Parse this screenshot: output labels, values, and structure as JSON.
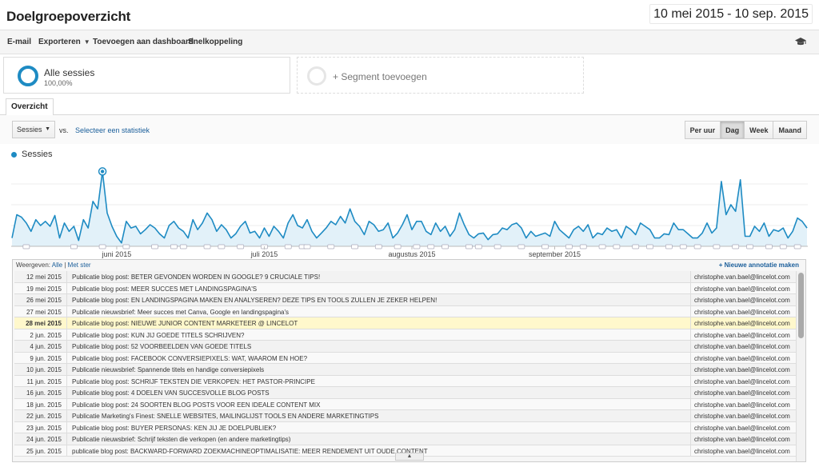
{
  "header": {
    "title": "Doelgroepoverzicht",
    "date_start": "10 mei 2015",
    "date_sep": "-",
    "date_end": "10 sep. 2015"
  },
  "toolbar": {
    "email_label": "E-mail",
    "export_label": "Exporteren",
    "dashboard_label": "Toevoegen aan dashboard",
    "shortcut_label": "Snelkoppeling",
    "icon": "mortarboard-icon"
  },
  "segments": {
    "all_sessions_label": "Alle sessies",
    "all_sessions_pct": "100,00%",
    "add_segment_label": "+ Segment toevoegen"
  },
  "tabs": {
    "overview_label": "Overzicht"
  },
  "controls": {
    "metric_label": "Sessies",
    "vs_label": "vs.",
    "select_stat_label": "Selecteer een statistiek",
    "period_buttons": [
      "Per uur",
      "Dag",
      "Week",
      "Maand"
    ],
    "active_period": "Dag"
  },
  "chart_data": {
    "type": "area",
    "series": [
      {
        "name": "Sessies",
        "color": "#1e8bc3"
      }
    ],
    "x_tick_labels": [
      "juni 2015",
      "juli 2015",
      "augustus 2015",
      "september 2015"
    ],
    "values": [
      0.1,
      0.38,
      0.35,
      0.28,
      0.18,
      0.32,
      0.25,
      0.3,
      0.24,
      0.37,
      0.1,
      0.28,
      0.18,
      0.24,
      0.07,
      0.32,
      0.22,
      0.54,
      0.45,
      0.9,
      0.4,
      0.24,
      0.12,
      0.04,
      0.3,
      0.22,
      0.24,
      0.15,
      0.2,
      0.26,
      0.22,
      0.15,
      0.1,
      0.25,
      0.3,
      0.22,
      0.18,
      0.1,
      0.32,
      0.2,
      0.28,
      0.4,
      0.32,
      0.18,
      0.26,
      0.2,
      0.1,
      0.15,
      0.24,
      0.3,
      0.16,
      0.18,
      0.1,
      0.22,
      0.12,
      0.24,
      0.18,
      0.1,
      0.28,
      0.38,
      0.25,
      0.22,
      0.32,
      0.18,
      0.1,
      0.16,
      0.22,
      0.3,
      0.26,
      0.36,
      0.28,
      0.45,
      0.3,
      0.24,
      0.14,
      0.3,
      0.26,
      0.18,
      0.2,
      0.28,
      0.1,
      0.16,
      0.26,
      0.38,
      0.2,
      0.3,
      0.3,
      0.18,
      0.14,
      0.28,
      0.18,
      0.24,
      0.12,
      0.2,
      0.4,
      0.26,
      0.14,
      0.1,
      0.15,
      0.16,
      0.08,
      0.14,
      0.15,
      0.22,
      0.2,
      0.26,
      0.28,
      0.22,
      0.1,
      0.18,
      0.12,
      0.14,
      0.16,
      0.12,
      0.3,
      0.2,
      0.15,
      0.1,
      0.2,
      0.24,
      0.18,
      0.26,
      0.1,
      0.16,
      0.14,
      0.22,
      0.18,
      0.2,
      0.1,
      0.24,
      0.2,
      0.14,
      0.28,
      0.24,
      0.2,
      0.1,
      0.1,
      0.15,
      0.14,
      0.28,
      0.2,
      0.2,
      0.15,
      0.1,
      0.1,
      0.16,
      0.28,
      0.16,
      0.22,
      0.78,
      0.38,
      0.5,
      0.42,
      0.8,
      0.12,
      0.12,
      0.24,
      0.18,
      0.28,
      0.12,
      0.2,
      0.18,
      0.22,
      0.1,
      0.18,
      0.34,
      0.3,
      0.22
    ],
    "highlight_index": 19,
    "has_annotations": true
  },
  "annotations": {
    "show_label": "Weergeven:",
    "all_label": "Alle",
    "divider": "|",
    "starred_label": "Met ster",
    "new_label": "+ Nieuwe annotatie maken",
    "rows": [
      {
        "date": "12 mei 2015",
        "text": "Publicatie blog post: BETER GEVONDEN WORDEN IN GOOGLE? 9 CRUCIALE TIPS!",
        "user": "christophe.van.bael@lincelot.com"
      },
      {
        "date": "19 mei 2015",
        "text": "Publicatie blog post: MEER SUCCES MET LANDINGSPAGINA'S",
        "user": "christophe.van.bael@lincelot.com"
      },
      {
        "date": "26 mei 2015",
        "text": "Publicatie blog post: EN LANDINGSPAGINA MAKEN EN ANALYSEREN? DEZE TIPS EN TOOLS ZULLEN JE ZEKER HELPEN!",
        "user": "christophe.van.bael@lincelot.com"
      },
      {
        "date": "27 mei 2015",
        "text": "Publicatie nieuwsbrief: Meer succes met Canva, Google en landingspagina's",
        "user": "christophe.van.bael@lincelot.com"
      },
      {
        "date": "28 mei 2015",
        "text": "Publicatie blog post: NIEUWE JUNIOR CONTENT MARKETEER @ LINCELOT",
        "user": "christophe.van.bael@lincelot.com",
        "highlight": true
      },
      {
        "date": "2 jun. 2015",
        "text": "Publicatie blog post: KUN JIJ GOEDE TITELS SCHRIJVEN?",
        "user": "christophe.van.bael@lincelot.com"
      },
      {
        "date": "4 jun. 2015",
        "text": "Publicatie blog post: 52 VOORBEELDEN VAN GOEDE TITELS",
        "user": "christophe.van.bael@lincelot.com"
      },
      {
        "date": "9 jun. 2015",
        "text": "Publicatie blog post: FACEBOOK CONVERSIEPIXELS: WAT, WAAROM EN HOE?",
        "user": "christophe.van.bael@lincelot.com"
      },
      {
        "date": "10 jun. 2015",
        "text": "Publicatie nieuwsbrief: Spannende titels en handige conversiepixels",
        "user": "christophe.van.bael@lincelot.com"
      },
      {
        "date": "11 jun. 2015",
        "text": "Publicatie blog post: SCHRIJF TEKSTEN DIE VERKOPEN: HET PASTOR-PRINCIPE",
        "user": "christophe.van.bael@lincelot.com"
      },
      {
        "date": "16 jun. 2015",
        "text": "Publicatie blog post: 4 DOELEN VAN SUCCESVOLLE BLOG POSTS",
        "user": "christophe.van.bael@lincelot.com"
      },
      {
        "date": "18 jun. 2015",
        "text": "Publicatie blog post: 24 SOORTEN BLOG POSTS VOOR EEN IDEALE CONTENT MIX",
        "user": "christophe.van.bael@lincelot.com"
      },
      {
        "date": "22 jun. 2015",
        "text": "Publicatie Marketing's Finest: SNELLE WEBSITES, MAILINGLIJST TOOLS EN ANDERE MARKETINGTIPS",
        "user": "christophe.van.bael@lincelot.com"
      },
      {
        "date": "23 jun. 2015",
        "text": "Publicatie blog post: BUYER PERSONAS: KEN JIJ JE DOELPUBLIEK?",
        "user": "christophe.van.bael@lincelot.com"
      },
      {
        "date": "24 jun. 2015",
        "text": "Publicatie nieuwsbrief: Schrijf teksten die verkopen (en andere marketingtips)",
        "user": "christophe.van.bael@lincelot.com"
      },
      {
        "date": "25 jun. 2015",
        "text": "publicatie blog post: BACKWARD-FORWARD ZOEKMACHINEOPTIMALISATIE: MEER RENDEMENT UIT OUDE CONTENT",
        "user": "christophe.van.bael@lincelot.com"
      }
    ]
  }
}
